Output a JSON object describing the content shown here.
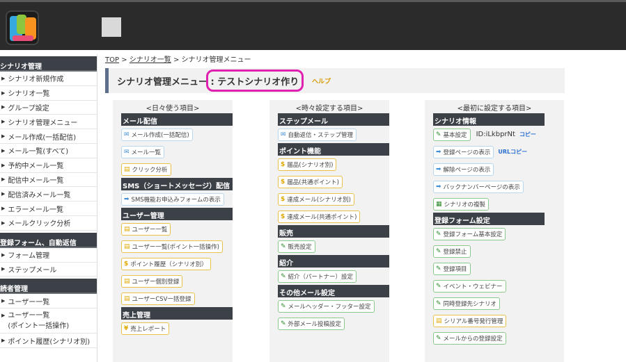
{
  "sidebar": {
    "sections": [
      {
        "title": "シナリオ管理",
        "items": [
          "シナリオ新規作成",
          "シナリオ一覧",
          "グループ設定",
          "シナリオ管理メニュー",
          "メール作成(一括配信)",
          "メール一覧(すべて)",
          "予約中メール一覧",
          "配信中メール一覧",
          "配信済みメール一覧",
          "エラーメール一覧",
          "メールクリック分析"
        ]
      },
      {
        "title": "登録フォーム、自動返信",
        "items": [
          "フォーム管理",
          "ステップメール"
        ]
      },
      {
        "title": "読者管理",
        "items": [
          "ユーザー一覧",
          "ユーザー一覧\n(ポイント一括操作)",
          "ポイント履歴(シナリオ別)"
        ]
      }
    ]
  },
  "breadcrumb": {
    "top": "TOP",
    "sep": ">",
    "list": "シナリオ一覧",
    "current": "シナリオ管理メニュー"
  },
  "title": {
    "label": "シナリオ管理メニュー : テストシナリオ作り",
    "help": "ヘルプ"
  },
  "columns": [
    {
      "heading": "<日々使う項目>",
      "sections": [
        {
          "title": "メール配信",
          "buttons": [
            {
              "label": "メール作成(一括配信)",
              "icon": "mail-icon",
              "style": "blue"
            },
            {
              "label": "メール一覧",
              "icon": "mail-icon",
              "style": "blue"
            },
            {
              "label": "クリック分析",
              "icon": "chart-icon",
              "style": "yellow"
            }
          ]
        },
        {
          "title": "SMS（ショートメッセージ）配信",
          "buttons": [
            {
              "label": "SMS機能お申込みフォームの表示",
              "icon": "arrow-icon",
              "style": "blue"
            }
          ]
        },
        {
          "title": "ユーザー管理",
          "buttons": [
            {
              "label": "ユーザー一覧",
              "icon": "chart-icon",
              "style": "yellow"
            },
            {
              "label": "ユーザー一覧(ポイント一括操作)",
              "icon": "chart-icon",
              "style": "yellow"
            },
            {
              "label": "ポイント履歴（シナリオ別）",
              "icon": "dollar-icon",
              "style": "yellow"
            },
            {
              "label": "ユーザー個別登録",
              "icon": "chart-icon",
              "style": "yellow"
            },
            {
              "label": "ユーザーCSV一括登録",
              "icon": "chart-icon",
              "style": "yellow"
            }
          ]
        },
        {
          "title": "売上管理",
          "buttons": [
            {
              "label": "売上レポート",
              "icon": "yen-icon",
              "style": "yellow"
            }
          ]
        }
      ]
    },
    {
      "heading": "<時々設定する項目>",
      "sections": [
        {
          "title": "ステップメール",
          "buttons": [
            {
              "label": "自動返信・ステップ管理",
              "icon": "mail-icon",
              "style": "blue"
            }
          ]
        },
        {
          "title": "ポイント機能",
          "buttons": [
            {
              "label": "届品(シナリオ別)",
              "icon": "dollar-icon",
              "style": "yellow"
            },
            {
              "label": "届品(共通ポイント)",
              "icon": "dollar-icon",
              "style": "yellow"
            },
            {
              "label": "達成メール(シナリオ別)",
              "icon": "dollar-icon",
              "style": "yellow"
            },
            {
              "label": "達成メール(共通ポイント)",
              "icon": "dollar-icon",
              "style": "yellow"
            }
          ]
        },
        {
          "title": "販売",
          "buttons": [
            {
              "label": "販売設定",
              "icon": "pen-icon",
              "style": "green"
            }
          ]
        },
        {
          "title": "紹介",
          "buttons": [
            {
              "label": "紹介（パートナー）設定",
              "icon": "pen-icon",
              "style": "green"
            }
          ]
        },
        {
          "title": "その他メール設定",
          "buttons": [
            {
              "label": "メールヘッダー・フッター設定",
              "icon": "pen-icon",
              "style": "green"
            },
            {
              "label": "外部メール投稿設定",
              "icon": "pen-icon",
              "style": "green"
            }
          ]
        }
      ]
    },
    {
      "heading": "<最初に設定する項目>",
      "sections": [
        {
          "title": "シナリオ情報",
          "buttons": [
            {
              "label": "基本設定",
              "icon": "pen-icon",
              "style": "green",
              "extra": "ID:iLkbprNt",
              "copy": "コピー"
            },
            {
              "label": "登録ページの表示",
              "icon": "arrow-icon",
              "style": "blue",
              "copy": "URLコピー"
            },
            {
              "label": "解除ページの表示",
              "icon": "arrow-icon",
              "style": "blue"
            },
            {
              "label": "バックナンバーページの表示",
              "icon": "arrow-icon",
              "style": "blue"
            },
            {
              "label": "シナリオの複製",
              "icon": "doc-icon",
              "style": "green"
            }
          ]
        },
        {
          "title": "登録フォーム設定",
          "buttons": [
            {
              "label": "登録フォーム基本設定",
              "icon": "pen-icon",
              "style": "green"
            },
            {
              "label": "登録禁止",
              "icon": "pen-icon",
              "style": "green"
            },
            {
              "label": "登録項目",
              "icon": "pen-icon",
              "style": "green"
            },
            {
              "label": "イベント・ウェビナー",
              "icon": "pen-icon",
              "style": "green"
            },
            {
              "label": "同時登録先シナリオ",
              "icon": "pen-icon",
              "style": "green"
            },
            {
              "label": "シリアル番号発行管理",
              "icon": "chart-icon",
              "style": "yellow"
            },
            {
              "label": "メールからの登録設定",
              "icon": "pen-icon",
              "style": "green"
            }
          ]
        }
      ]
    }
  ],
  "colors": {
    "topbar": "#2b2b2b",
    "section_head": "#3c4047",
    "highlight": "#e020b0",
    "help": "#d69a00"
  }
}
